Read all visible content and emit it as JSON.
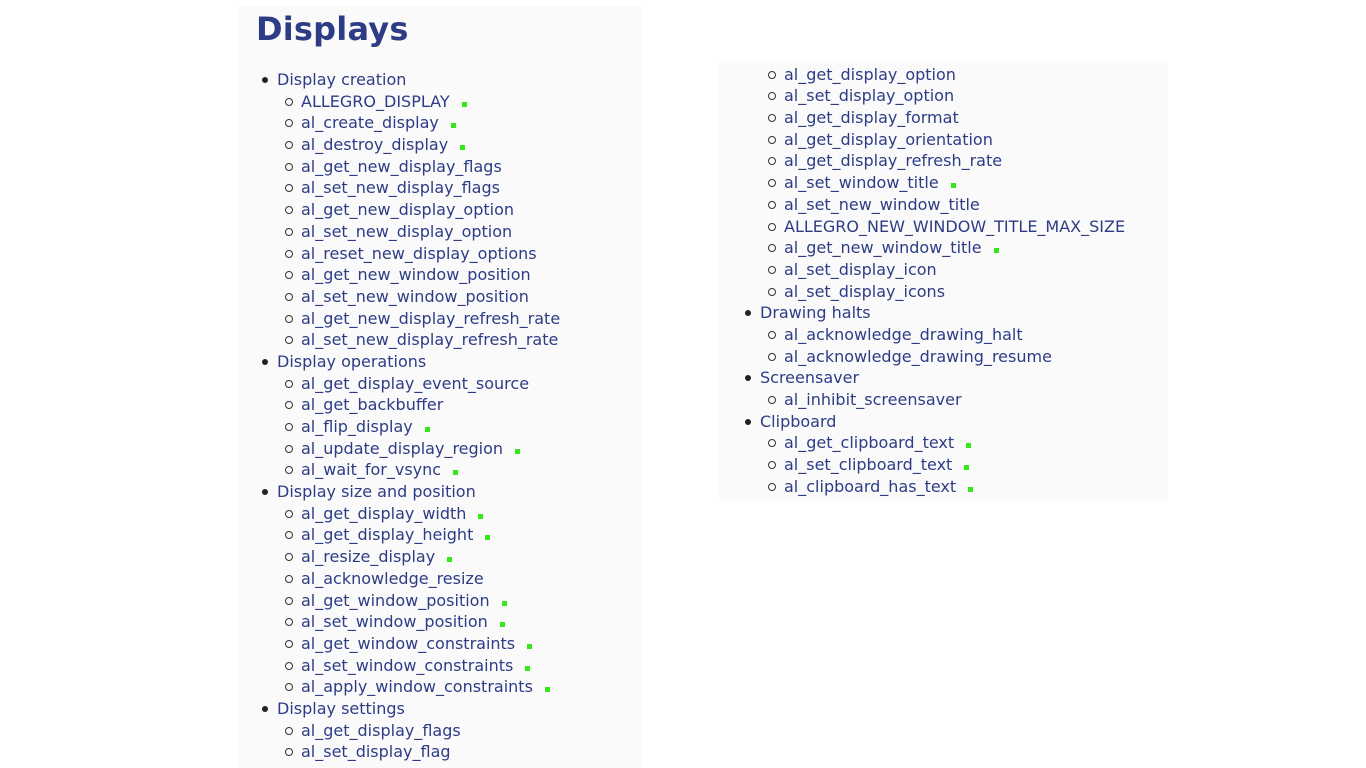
{
  "title": "Displays",
  "left_sections": [
    {
      "label": "Display creation",
      "items": [
        {
          "label": "ALLEGRO_DISPLAY",
          "mark": true
        },
        {
          "label": "al_create_display",
          "mark": true
        },
        {
          "label": "al_destroy_display",
          "mark": true
        },
        {
          "label": "al_get_new_display_flags",
          "mark": false
        },
        {
          "label": "al_set_new_display_flags",
          "mark": false
        },
        {
          "label": "al_get_new_display_option",
          "mark": false
        },
        {
          "label": "al_set_new_display_option",
          "mark": false
        },
        {
          "label": "al_reset_new_display_options",
          "mark": false
        },
        {
          "label": "al_get_new_window_position",
          "mark": false
        },
        {
          "label": "al_set_new_window_position",
          "mark": false
        },
        {
          "label": "al_get_new_display_refresh_rate",
          "mark": false
        },
        {
          "label": "al_set_new_display_refresh_rate",
          "mark": false
        }
      ]
    },
    {
      "label": "Display operations",
      "items": [
        {
          "label": "al_get_display_event_source",
          "mark": false
        },
        {
          "label": "al_get_backbuffer",
          "mark": false
        },
        {
          "label": "al_flip_display",
          "mark": true
        },
        {
          "label": "al_update_display_region",
          "mark": true
        },
        {
          "label": "al_wait_for_vsync",
          "mark": true
        }
      ]
    },
    {
      "label": "Display size and position",
      "items": [
        {
          "label": "al_get_display_width",
          "mark": true
        },
        {
          "label": "al_get_display_height",
          "mark": true
        },
        {
          "label": "al_resize_display",
          "mark": true
        },
        {
          "label": "al_acknowledge_resize",
          "mark": false
        },
        {
          "label": "al_get_window_position",
          "mark": true
        },
        {
          "label": "al_set_window_position",
          "mark": true
        },
        {
          "label": "al_get_window_constraints",
          "mark": true
        },
        {
          "label": "al_set_window_constraints",
          "mark": true
        },
        {
          "label": "al_apply_window_constraints",
          "mark": true
        }
      ]
    },
    {
      "label": "Display settings",
      "items": [
        {
          "label": "al_get_display_flags",
          "mark": false
        },
        {
          "label": "al_set_display_flag",
          "mark": false
        }
      ]
    }
  ],
  "right_sections": [
    {
      "label": "",
      "items": [
        {
          "label": "al_get_display_option",
          "mark": false
        },
        {
          "label": "al_set_display_option",
          "mark": false
        },
        {
          "label": "al_get_display_format",
          "mark": false
        },
        {
          "label": "al_get_display_orientation",
          "mark": false
        },
        {
          "label": "al_get_display_refresh_rate",
          "mark": false
        },
        {
          "label": "al_set_window_title",
          "mark": true
        },
        {
          "label": "al_set_new_window_title",
          "mark": false
        },
        {
          "label": "ALLEGRO_NEW_WINDOW_TITLE_MAX_SIZE",
          "mark": false
        },
        {
          "label": "al_get_new_window_title",
          "mark": true
        },
        {
          "label": "al_set_display_icon",
          "mark": false
        },
        {
          "label": "al_set_display_icons",
          "mark": false
        }
      ]
    },
    {
      "label": "Drawing halts",
      "items": [
        {
          "label": "al_acknowledge_drawing_halt",
          "mark": false
        },
        {
          "label": "al_acknowledge_drawing_resume",
          "mark": false
        }
      ]
    },
    {
      "label": "Screensaver",
      "items": [
        {
          "label": "al_inhibit_screensaver",
          "mark": false
        }
      ]
    },
    {
      "label": "Clipboard",
      "items": [
        {
          "label": "al_get_clipboard_text",
          "mark": true
        },
        {
          "label": "al_set_clipboard_text",
          "mark": true
        },
        {
          "label": "al_clipboard_has_text",
          "mark": true
        }
      ]
    }
  ],
  "colors": {
    "link": "#2d3c85",
    "heading": "#2d3c85",
    "marker": "#35e819",
    "panel_bg": "#fafafa"
  }
}
